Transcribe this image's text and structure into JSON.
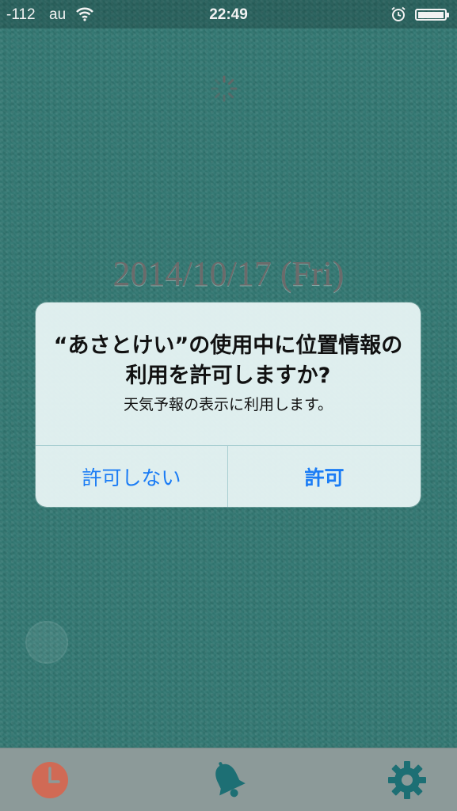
{
  "status_bar": {
    "signal": "-112",
    "carrier": "au",
    "time": "22:49",
    "icons": [
      "wifi-icon",
      "alarm-clock-icon",
      "battery-icon"
    ]
  },
  "main": {
    "date": "2014/10/17 (Fri)"
  },
  "alert": {
    "title": "“あさとけい”の使用中に位置情報の利用を許可しますか?",
    "message": "天気予報の表示に利用します。",
    "deny_label": "許可しない",
    "allow_label": "許可"
  },
  "tab_bar": {
    "items": [
      {
        "icon": "clock-icon",
        "color": "#d06a55"
      },
      {
        "icon": "bell-icon",
        "color": "#1d6f74"
      },
      {
        "icon": "gear-icon",
        "color": "#1d6f74"
      }
    ]
  },
  "colors": {
    "background": "#3a8a84",
    "accent": "#1a7cf5",
    "tab_bar": "#8c9a99"
  }
}
